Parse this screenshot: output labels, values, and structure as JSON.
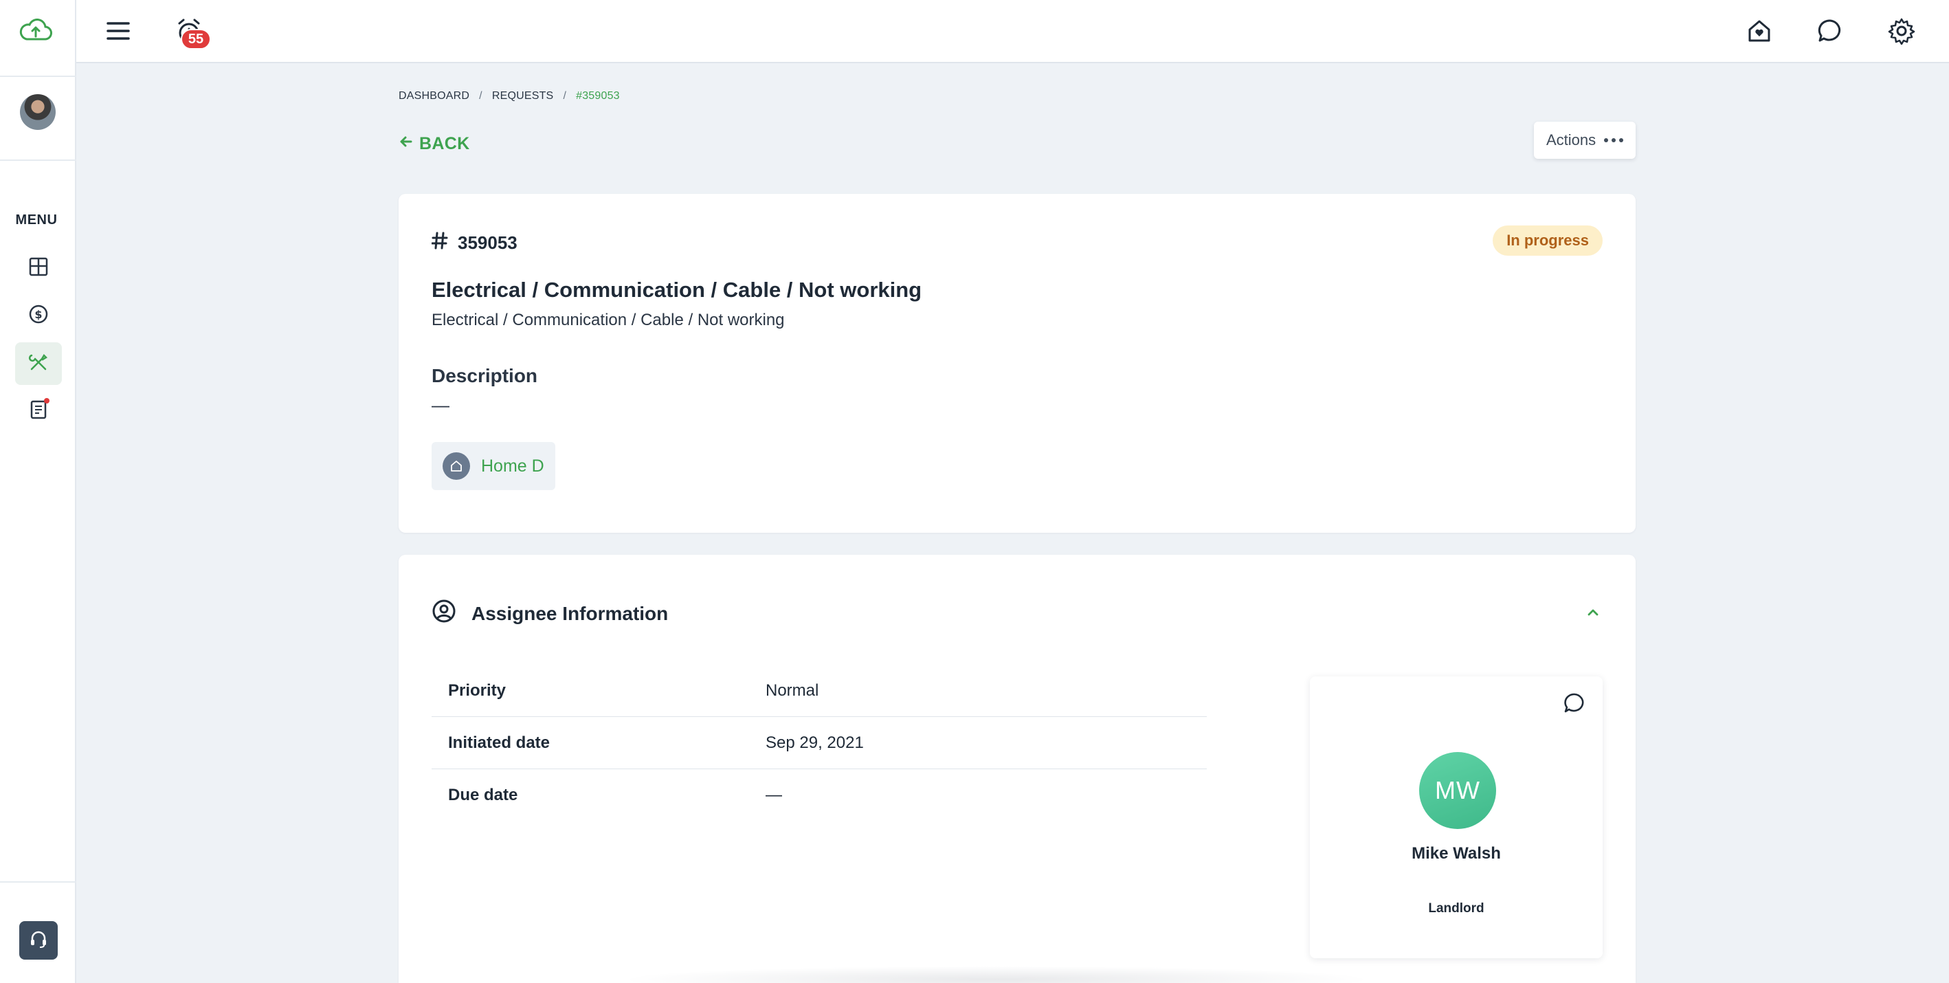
{
  "sidebar": {
    "menu_label": "MENU",
    "items": [
      {
        "icon": "dashboard-grid-icon"
      },
      {
        "icon": "dollar-icon"
      },
      {
        "icon": "tools-icon",
        "active": true
      },
      {
        "icon": "document-icon",
        "notification": true
      }
    ]
  },
  "topbar": {
    "alarm_count": "55"
  },
  "breadcrumb": [
    "DASHBOARD",
    "REQUESTS",
    "#359053"
  ],
  "back_label": "BACK",
  "actions_label": "Actions",
  "request": {
    "id": "359053",
    "status": "In progress",
    "title": "Electrical / Communication / Cable / Not working",
    "subtitle": "Electrical / Communication / Cable / Not working",
    "description_label": "Description",
    "description_value": "—",
    "property": "Home D"
  },
  "assignee": {
    "section_title": "Assignee Information",
    "rows": [
      {
        "label": "Priority",
        "value": "Normal"
      },
      {
        "label": "Initiated date",
        "value": "Sep 29, 2021"
      },
      {
        "label": "Due date",
        "value": "—"
      }
    ],
    "person": {
      "initials": "MW",
      "name": "Mike Walsh",
      "role": "Landlord"
    }
  },
  "colors": {
    "accent": "#3ea34f",
    "badge_red": "#e03b3b",
    "status_bg": "#fdefc9",
    "status_text": "#b0611a"
  }
}
